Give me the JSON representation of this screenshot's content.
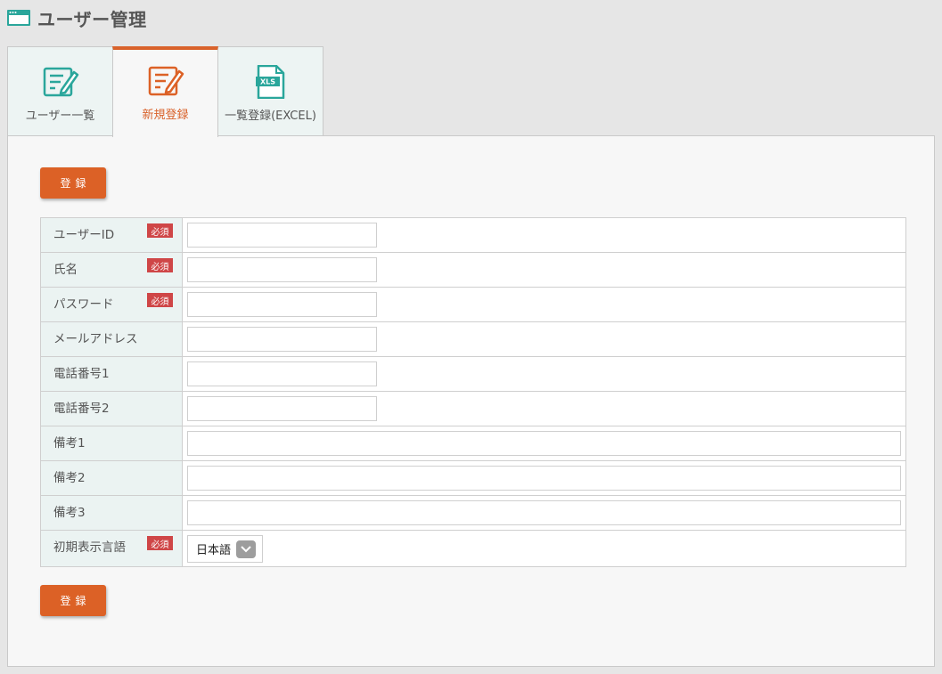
{
  "header": {
    "title": "ユーザー管理",
    "icon": "window-icon"
  },
  "tabs": [
    {
      "label": "ユーザー一覧",
      "icon": "edit-list-icon",
      "active": false
    },
    {
      "label": "新規登録",
      "icon": "edit-new-icon",
      "active": true
    },
    {
      "label": "一覧登録(EXCEL)",
      "icon": "xls-file-icon",
      "active": false
    }
  ],
  "colors": {
    "accent": "#dc6126",
    "teal": "#2aa69b",
    "required": "#cf4647",
    "label_bg": "#ebf3f2"
  },
  "buttons": {
    "register": "登録"
  },
  "form": {
    "required_badge": "必須",
    "fields": [
      {
        "label": "ユーザーID",
        "required": true,
        "value": ""
      },
      {
        "label": "氏名",
        "required": true,
        "value": ""
      },
      {
        "label": "パスワード",
        "required": true,
        "value": ""
      },
      {
        "label": "メールアドレス",
        "required": false,
        "value": ""
      },
      {
        "label": "電話番号1",
        "required": false,
        "value": ""
      },
      {
        "label": "電話番号2",
        "required": false,
        "value": ""
      },
      {
        "label": "備考1",
        "required": false,
        "value": ""
      },
      {
        "label": "備考2",
        "required": false,
        "value": ""
      },
      {
        "label": "備考3",
        "required": false,
        "value": ""
      },
      {
        "label": "初期表示言語",
        "required": true,
        "value": "日本語"
      }
    ]
  }
}
